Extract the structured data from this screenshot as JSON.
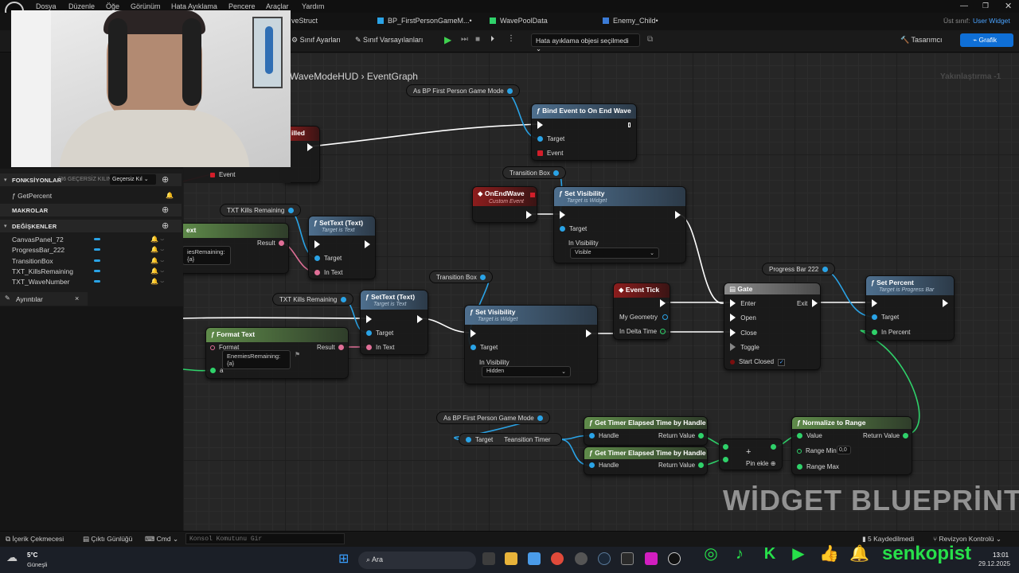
{
  "menu": {
    "items": [
      "Dosya",
      "Düzenle",
      "Öğe",
      "Görünüm",
      "Hata Ayıklama",
      "Pencere",
      "Araçlar",
      "Yardım"
    ]
  },
  "tabs": [
    "veStruct",
    "BP_FirstPersonGameM...•",
    "WavePoolData",
    "Enemy_Child•"
  ],
  "parent_class": {
    "label": "Üst sınıf:",
    "value": "User Widget"
  },
  "toolbar": {
    "class_settings": "Sınıf Ayarları",
    "class_defaults": "Sınıf Varsayılanları",
    "debug_select": "Hata ayıklama objesi seçilmedi",
    "designer": "Tasarımcı",
    "graph": "Grafik"
  },
  "breadcrumb": {
    "widget": "WaveModeHUD",
    "graph": "EventGraph"
  },
  "zoom": "Yakınlaştırma -1",
  "watermark": "WİDGET BLUEPRİNT'İ",
  "left_panel": {
    "functions_header": "FONKSİYONLAR",
    "functions_note": "(36 GEÇERSİZ KILIN",
    "override_button": "Geçersiz Kıl",
    "functions": [
      "GetPercent"
    ],
    "macros_header": "MAKROLAR",
    "variables_header": "DEĞİŞKENLER",
    "variables": [
      "CanvasPanel_72",
      "ProgressBar_222",
      "TransitionBox",
      "TXT_KillsRemaining",
      "TXT_WaveNumber"
    ],
    "details_tab": "Ayrıntılar"
  },
  "nodes": {
    "as_bp_fp_game_mode_1": "As BP First Person Game Mode",
    "bind_event": {
      "title": "Bind Event to On End Wave",
      "target": "Target",
      "event": "Event"
    },
    "killed": "illed",
    "event_pin": "Event",
    "transition_box_1": "Transition Box",
    "on_end_wave": {
      "title": "OnEndWave",
      "sub": "Custom Event"
    },
    "set_visibility_1": {
      "title": "Set Visibility",
      "sub": "Target is Widget",
      "target": "Target",
      "in_visibility": "In Visibility",
      "value": "Visible"
    },
    "txt_kills_1": "TXT Kills Remaining",
    "settext_1": {
      "title": "SetText (Text)",
      "sub": "Target is Text",
      "target": "Target",
      "in_text": "In Text"
    },
    "ext_stub": "ext",
    "result_1": "Result",
    "format_stub": "iesRemaining:{a}",
    "transition_box_2": "Transition Box",
    "progress_bar": "Progress Bar 222",
    "set_percent": {
      "title": "Set Percent",
      "sub": "Target is Progress Bar",
      "target": "Target",
      "in_percent": "In Percent"
    },
    "event_tick": {
      "title": "Event Tick",
      "my_geometry": "My Geometry",
      "in_delta": "In Delta Time"
    },
    "gate": {
      "title": "Gate",
      "enter": "Enter",
      "exit": "Exit",
      "open": "Open",
      "close": "Close",
      "toggle": "Toggle",
      "start_closed": "Start Closed"
    },
    "txt_kills_2": "TXT Kills Remaining",
    "settext_2": {
      "title": "SetText (Text)",
      "sub": "Target is Text",
      "target": "Target",
      "in_text": "In Text"
    },
    "set_visibility_2": {
      "title": "Set Visibility",
      "sub": "Target is Widget",
      "target": "Target",
      "in_visibility": "In Visibility",
      "value": "Hidden"
    },
    "format_text": {
      "title": "Format Text",
      "format": "Format",
      "format_value": "EnemiesRemaining:{a}",
      "result": "Result",
      "a": "a"
    },
    "as_bp_fp_game_mode_2": "As BP First Person Game Mode",
    "transition_timer": {
      "target": "Target",
      "output": "Teansition Timer"
    },
    "get_timer_1": {
      "title": "Get Timer Elapsed Time by Handle",
      "handle": "Handle",
      "return": "Return Value"
    },
    "get_timer_2": {
      "title": "Get Timer Elapsed Time by Handle",
      "handle": "Handle",
      "return": "Return Value"
    },
    "add_pin": "Pin ekle",
    "normalize": {
      "title": "Normalize to Range",
      "value": "Value",
      "return": "Return Value",
      "range_min": "Range Min",
      "range_min_val": "0,0",
      "range_max": "Range Max"
    }
  },
  "statusbar": {
    "content_drawer": "İçerik Çekmecesi",
    "output_log": "Çıktı Günlüğü",
    "cmd": "Cmd",
    "console_placeholder": "Konsol Komutunu Gir",
    "saved": "5 Kaydedilmedi",
    "revision": "Revizyon Kontrolü"
  },
  "taskbar": {
    "temp": "5°C",
    "weather": "Güneşli",
    "search": "Ara",
    "time": "13:01",
    "date": "29.12.2025"
  },
  "brand": "senkopist",
  "colors": {
    "accent": "#0f6fd6",
    "exec": "#ffffff",
    "object_pin": "#2aa3e6",
    "text_pin": "#e06f97",
    "float_pin": "#2fd16a",
    "social": "#27e04a"
  }
}
